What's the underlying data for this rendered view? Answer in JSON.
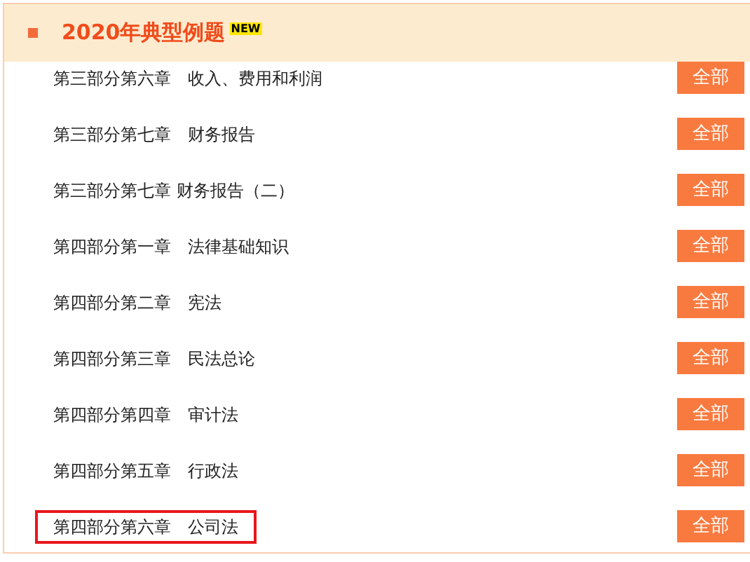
{
  "section": {
    "title": "2020年典型例题",
    "badge": "NEW"
  },
  "rows": [
    {
      "label": "第三部分第六章　收入、费用和利润",
      "button": "全部",
      "highlighted": false
    },
    {
      "label": "第三部分第七章　财务报告",
      "button": "全部",
      "highlighted": false
    },
    {
      "label": "第三部分第七章 财务报告（二）",
      "button": "全部",
      "highlighted": false
    },
    {
      "label": "第四部分第一章　法律基础知识",
      "button": "全部",
      "highlighted": false
    },
    {
      "label": "第四部分第二章　宪法",
      "button": "全部",
      "highlighted": false
    },
    {
      "label": "第四部分第三章　民法总论",
      "button": "全部",
      "highlighted": false
    },
    {
      "label": "第四部分第四章　审计法",
      "button": "全部",
      "highlighted": false
    },
    {
      "label": "第四部分第五章　行政法",
      "button": "全部",
      "highlighted": false
    },
    {
      "label": "第四部分第六章　公司法",
      "button": "全部",
      "highlighted": true
    }
  ]
}
